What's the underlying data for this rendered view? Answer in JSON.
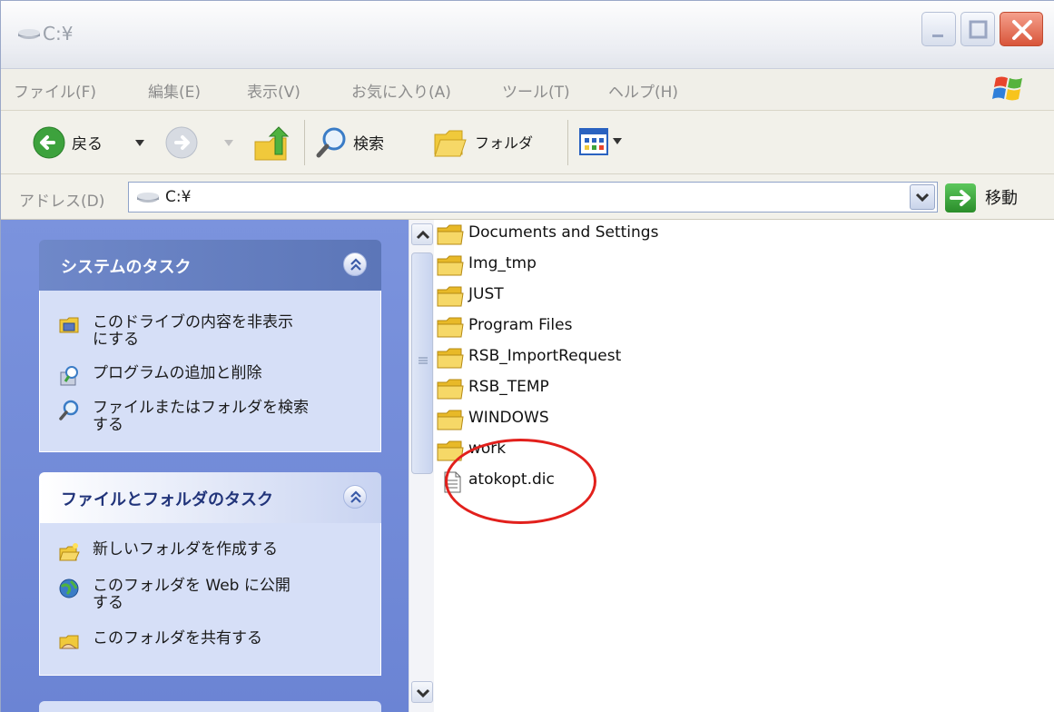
{
  "window": {
    "title": "C:¥"
  },
  "menu": [
    {
      "label": "ファイル(F)"
    },
    {
      "label": "編集(E)"
    },
    {
      "label": "表示(V)"
    },
    {
      "label": "お気に入り(A)"
    },
    {
      "label": "ツール(T)"
    },
    {
      "label": "ヘルプ(H)"
    }
  ],
  "toolbar": {
    "back_label": "戻る",
    "search_label": "検索",
    "folders_label": "フォルダ"
  },
  "address": {
    "label": "アドレス(D)",
    "value": "C:¥",
    "go_label": "移動"
  },
  "sidebar": {
    "system_tasks": {
      "title": "システムのタスク",
      "items": [
        {
          "label": "このドライブの内容を非表示\nにする",
          "icon": "hide-drive-icon"
        },
        {
          "label": "プログラムの追加と削除",
          "icon": "add-remove-programs-icon"
        },
        {
          "label": "ファイルまたはフォルダを検索\nする",
          "icon": "search-icon"
        }
      ]
    },
    "file_folder_tasks": {
      "title": "ファイルとフォルダのタスク",
      "items": [
        {
          "label": "新しいフォルダを作成する",
          "icon": "new-folder-icon"
        },
        {
          "label": "このフォルダを Web に公開\nする",
          "icon": "publish-web-icon"
        },
        {
          "label": "このフォルダを共有する",
          "icon": "share-folder-icon"
        }
      ]
    }
  },
  "files": [
    {
      "name": "Documents and Settings",
      "type": "folder"
    },
    {
      "name": "Img_tmp",
      "type": "folder"
    },
    {
      "name": "JUST",
      "type": "folder"
    },
    {
      "name": "Program Files",
      "type": "folder"
    },
    {
      "name": "RSB_ImportRequest",
      "type": "folder"
    },
    {
      "name": "RSB_TEMP",
      "type": "folder"
    },
    {
      "name": "WINDOWS",
      "type": "folder"
    },
    {
      "name": "work",
      "type": "folder"
    },
    {
      "name": "atokopt.dic",
      "type": "file"
    }
  ],
  "colors": {
    "task_pane": "#7b93dd",
    "highlight_ring": "#e2201c",
    "folder": "#f0c93b"
  }
}
